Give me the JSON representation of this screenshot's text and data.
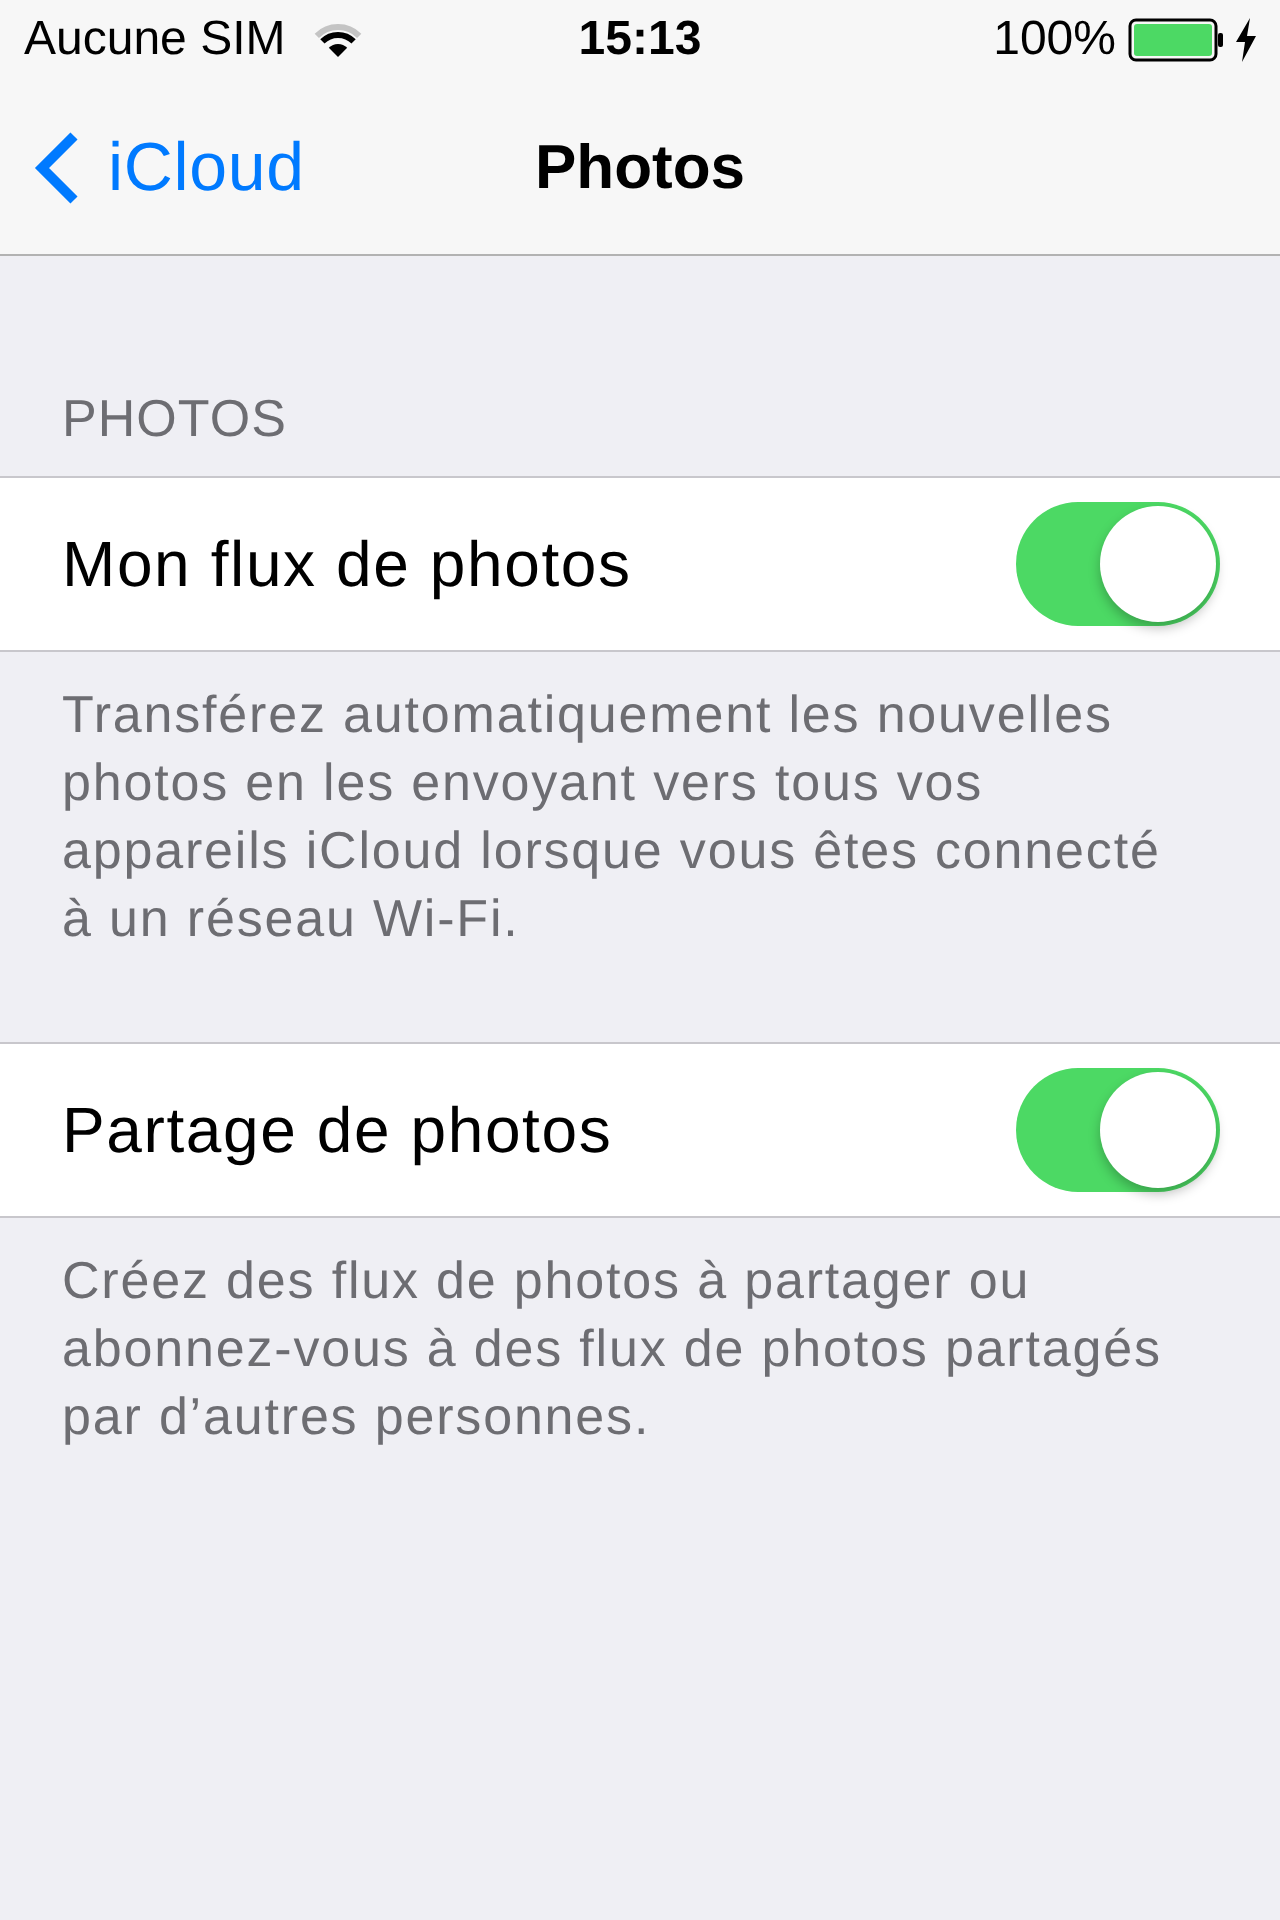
{
  "status_bar": {
    "carrier": "Aucune SIM",
    "time": "15:13",
    "battery": "100%",
    "charging": true
  },
  "nav_bar": {
    "back": "iCloud",
    "title": "Photos"
  },
  "groups": [
    {
      "header": "PHOTOS",
      "rows": [
        {
          "label": "Mon flux de photos",
          "on": true
        }
      ],
      "footer": "Transférez automatiquement les nouvelles photos en les envoyant vers tous vos appareils iCloud lorsque vous êtes connecté à un réseau Wi-Fi."
    },
    {
      "rows": [
        {
          "label": "Partage de photos",
          "on": true
        }
      ],
      "footer": "Créez des flux de photos à partager ou abonnez-vous à des flux de photos partagés par d’autres personnes."
    }
  ]
}
